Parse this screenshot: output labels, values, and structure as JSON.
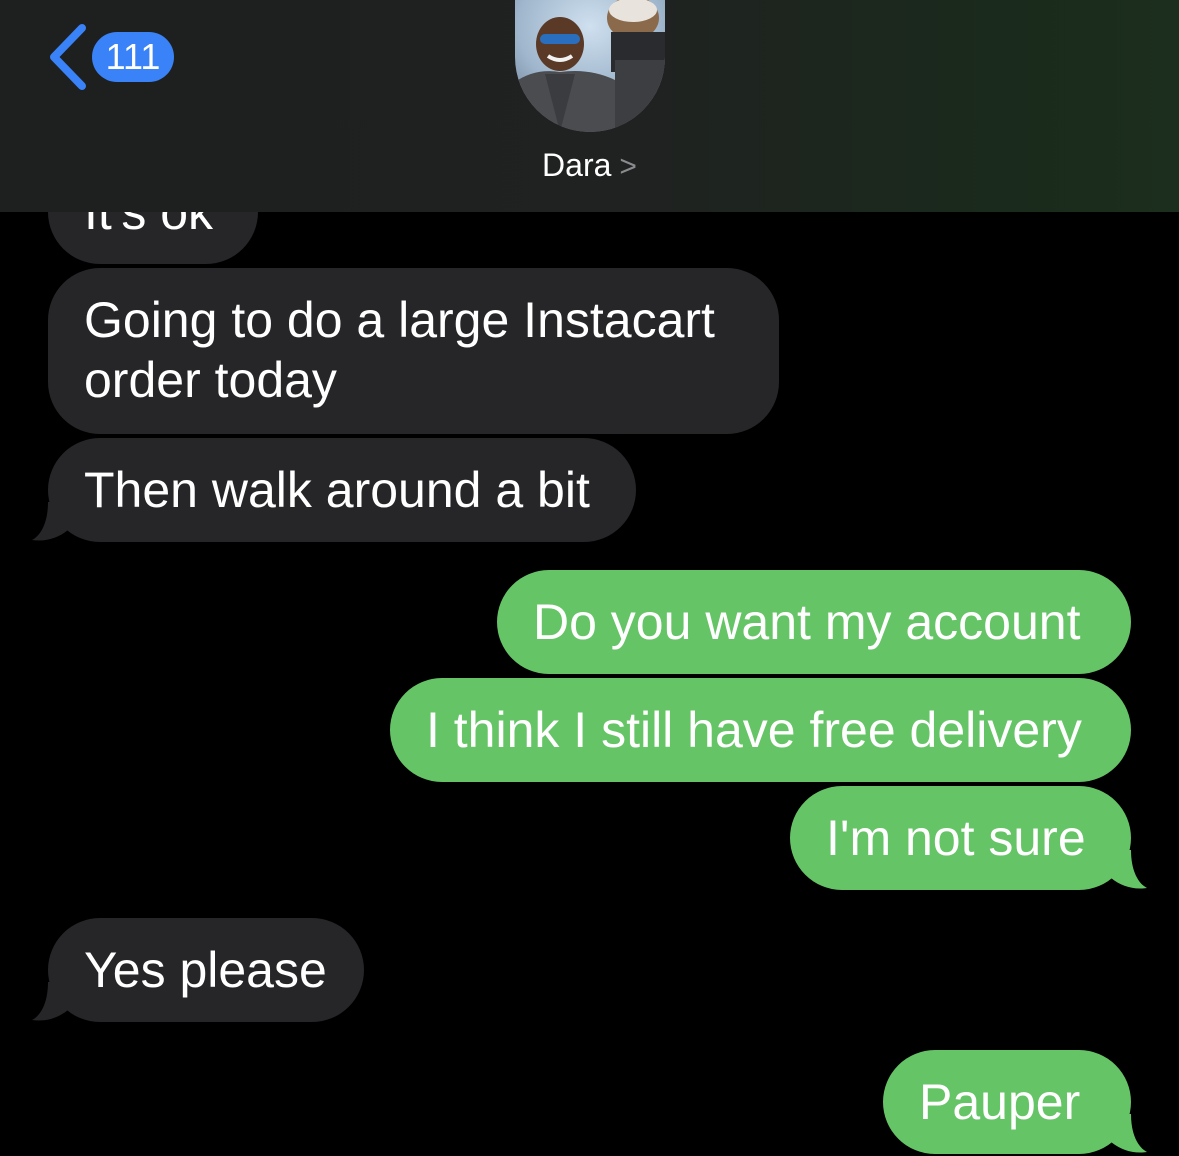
{
  "header": {
    "back_badge": "111",
    "contact_name": "Dara",
    "contact_chevron": ">"
  },
  "colors": {
    "accent_blue": "#3a82f7",
    "sent_bubble": "#65c466",
    "received_bubble": "#262629"
  },
  "messages": [
    {
      "direction": "received",
      "text": "It's ok"
    },
    {
      "direction": "received",
      "text": "Going to do a large Instacart order today"
    },
    {
      "direction": "received",
      "text": "Then walk around a bit"
    },
    {
      "direction": "sent",
      "text": "Do you want my account"
    },
    {
      "direction": "sent",
      "text": "I think I still have free delivery"
    },
    {
      "direction": "sent",
      "text": "I'm not sure"
    },
    {
      "direction": "received",
      "text": "Yes please"
    },
    {
      "direction": "sent",
      "text": "Pauper"
    }
  ]
}
